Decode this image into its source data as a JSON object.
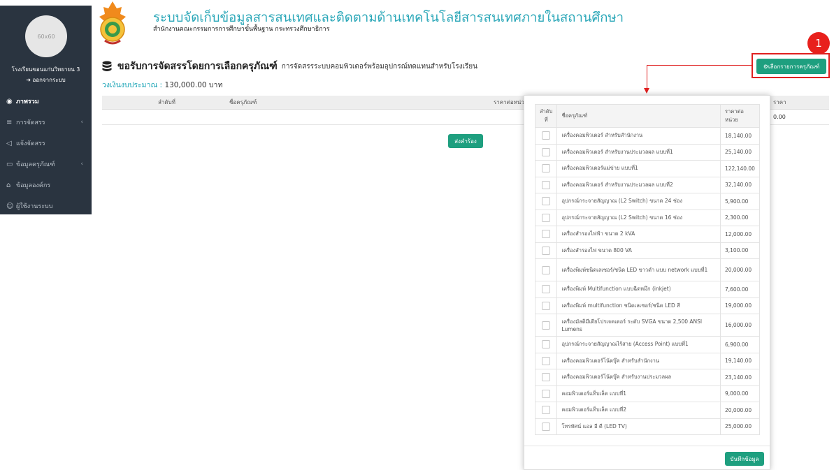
{
  "sidebar": {
    "avatar_text": "60x60",
    "school_name": "โรงเรียนขอนแก่นวิทยายน 3",
    "logout_label": "ออกจากระบบ",
    "items": [
      {
        "label": "ภาพรวม",
        "icon": "dashboard-icon",
        "active": true
      },
      {
        "label": "การจัดสรร",
        "icon": "database-icon",
        "has_submenu": true
      },
      {
        "label": "แจ้งจัดสรร",
        "icon": "bullhorn-icon"
      },
      {
        "label": "ข้อมูลครุภัณฑ์",
        "icon": "desktop-icon",
        "has_submenu": true
      },
      {
        "label": "ข้อมูลองค์กร",
        "icon": "institution-icon"
      },
      {
        "label": "ผู้ใช้งานระบบ",
        "icon": "users-icon"
      }
    ]
  },
  "header": {
    "title": "ระบบจัดเก็บข้อมูลสารสนเทศและติดตามด้านเทคโนโลยีสารสนเทศภายในสถานศึกษา",
    "subtitle": "สำนักงานคณะกรรมการการศึกษาขั้นพื้นฐาน กระทรวงศึกษาธิการ"
  },
  "page": {
    "heading": "ขอรับการจัดสรรโดยการเลือกครุภัณฑ์",
    "heading_sub": "การจัดสรรระบบคอมพิวเตอร์พร้อมอุปกรณ์ทดแทนสำหรับโรงเรียน",
    "budget_label": "วงเงินงบประมาณ :",
    "budget_value": "130,000.00 บาท",
    "select_button": "เลือกรายการครุภัณฑ์",
    "annotation_number": "1",
    "request_button": "ส่งคำร้อง",
    "save_button": "บันทึกข้อมูล"
  },
  "main_table": {
    "columns": [
      "ลำดับที่",
      "ชื่อครุภัณฑ์",
      "ราคาต่อหน่วย",
      "ราคา"
    ],
    "total_value": "0.00"
  },
  "modal": {
    "columns": [
      "ลำดับที่",
      "ชื่อครุภัณฑ์",
      "ราคาต่อหน่วย"
    ],
    "items": [
      {
        "name": "เครื่องคอมพิวเตอร์ สำหรับสำนักงาน",
        "price": "18,140.00"
      },
      {
        "name": "เครื่องคอมพิวเตอร์ สำหรับงานประมวลผล แบบที่1",
        "price": "25,140.00"
      },
      {
        "name": "เครื่องคอมพิวเตอร์แม่ข่าย แบบที่1",
        "price": "122,140.00"
      },
      {
        "name": "เครื่องคอมพิวเตอร์ สำหรับงานประมวลผล แบบที่2",
        "price": "32,140.00"
      },
      {
        "name": "อุปกรณ์กระจายสัญญาณ (L2 Switch) ขนาด 24 ช่อง",
        "price": "5,900.00"
      },
      {
        "name": "อุปกรณ์กระจายสัญญาณ (L2 Switch) ขนาด 16 ช่อง",
        "price": "2,300.00"
      },
      {
        "name": "เครื่องสำรองไฟฟ้า ขนาด 2 kVA",
        "price": "12,000.00"
      },
      {
        "name": "เครื่องสำรองไฟ ขนาด 800 VA",
        "price": "3,100.00"
      },
      {
        "name": "เครื่องพิมพ์ชนิดเลเซอร์/ชนิด LED ขาวดำ แบบ network แบบที่1",
        "price": "20,000.00"
      },
      {
        "name": "เครื่องพิมพ์ Multifunction แบบฉีดหมึก (inkjet)",
        "price": "7,600.00"
      },
      {
        "name": "เครื่องพิมพ์ multifunction ชนิดเลเซอร์/ชนิด LED สี",
        "price": "19,000.00"
      },
      {
        "name": "เครื่องมัลติมีเดียโปรเจคเตอร์ ระดับ SVGA ขนาด 2,500 ANSI Lumens",
        "price": "16,000.00"
      },
      {
        "name": "อุปกรณ์กระจายสัญญาณไร้สาย (Access Point) แบบที่1",
        "price": "6,900.00"
      },
      {
        "name": "เครื่องคอมพิวเตอร์โน้ตบุ๊ค สำหรับสำนักงาน",
        "price": "19,140.00"
      },
      {
        "name": "เครื่องคอมพิวเตอร์โน้ตบุ๊ค สำหรับงานประมวลผล",
        "price": "23,140.00"
      },
      {
        "name": "คอมพิวเตอร์แท็บเล็ต แบบที่1",
        "price": "9,000.00"
      },
      {
        "name": "คอมพิวเตอร์แท็บเล็ต แบบที่2",
        "price": "20,000.00"
      },
      {
        "name": "โทรทัศน์ แอล อี ดี (LED TV)",
        "price": "25,000.00"
      }
    ]
  },
  "colors": {
    "sidebar_bg": "#2a3440",
    "accent_teal": "#2aa7b8",
    "button_green": "#1e9f7f",
    "annotation_red": "#e02020"
  }
}
